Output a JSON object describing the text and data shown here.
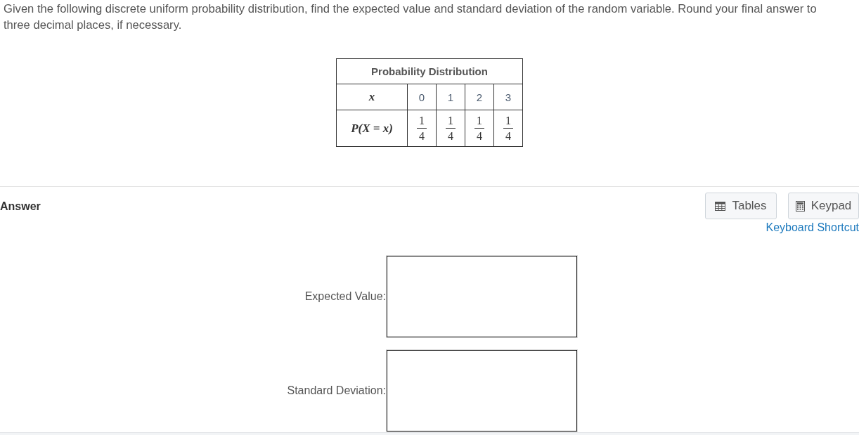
{
  "question": "Given the following discrete uniform probability distribution, find the expected value and standard deviation of the random variable. Round your final answer to three decimal places, if necessary.",
  "table": {
    "title": "Probability Distribution",
    "rows": [
      {
        "header": "x",
        "cells": [
          {
            "kind": "number",
            "text": "0"
          },
          {
            "kind": "number",
            "text": "1"
          },
          {
            "kind": "number",
            "text": "2"
          },
          {
            "kind": "number",
            "text": "3"
          }
        ]
      },
      {
        "header": "P(X = x)",
        "cells": [
          {
            "kind": "fraction",
            "numerator": "1",
            "denominator": "4"
          },
          {
            "kind": "fraction",
            "numerator": "1",
            "denominator": "4"
          },
          {
            "kind": "fraction",
            "numerator": "1",
            "denominator": "4"
          },
          {
            "kind": "fraction",
            "numerator": "1",
            "denominator": "4"
          }
        ]
      }
    ]
  },
  "answer": {
    "title": "Answer",
    "buttons": [
      {
        "label": "Tables"
      },
      {
        "label": "Keypad"
      }
    ],
    "link": "Keyboard Shortcut",
    "fields": [
      {
        "label": "Expected Value:"
      },
      {
        "label": "Standard Deviation:"
      }
    ]
  }
}
